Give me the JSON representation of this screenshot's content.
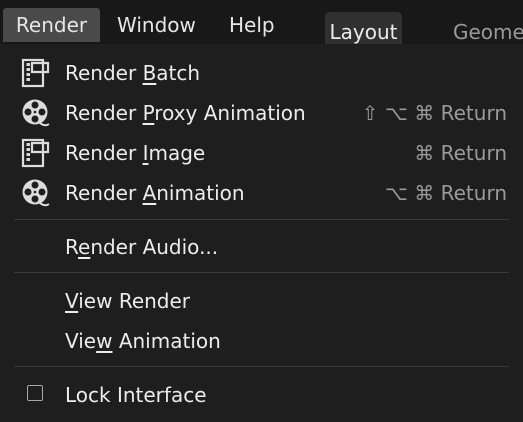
{
  "menubar": {
    "items": [
      "Render",
      "Window",
      "Help"
    ],
    "workspace_tabs": [
      "Layout",
      "Geome"
    ]
  },
  "render_menu": {
    "items": [
      {
        "pre": "Render ",
        "u": "B",
        "post": "atch",
        "shortcut": "",
        "icon": "render-still-icon"
      },
      {
        "pre": "Render ",
        "u": "P",
        "post": "roxy Animation",
        "shortcut": "⇧ ⌥ ⌘ Return",
        "icon": "render-animation-icon"
      },
      {
        "pre": "Render ",
        "u": "I",
        "post": "mage",
        "shortcut": "⌘ Return",
        "icon": "render-still-icon"
      },
      {
        "pre": "Render ",
        "u": "A",
        "post": "nimation",
        "shortcut": "⌥ ⌘ Return",
        "icon": "render-animation-icon"
      },
      {
        "pre": "R",
        "u": "e",
        "post": "nder Audio...",
        "shortcut": "",
        "icon": ""
      },
      {
        "pre": "",
        "u": "V",
        "post": "iew Render",
        "shortcut": "",
        "icon": ""
      },
      {
        "pre": "Vie",
        "u": "w",
        "post": " Animation",
        "shortcut": "",
        "icon": ""
      },
      {
        "pre": "",
        "u": "",
        "post": "Lock Interface",
        "shortcut": "",
        "icon": "checkbox"
      }
    ],
    "lock_interface_checked": false
  },
  "colors": {
    "background": "#1e1e1e",
    "menubar_bg": "#181818",
    "active_tab": "#4a4a4a",
    "text": "#ececec",
    "shortcut_text": "#9a9a9a"
  }
}
